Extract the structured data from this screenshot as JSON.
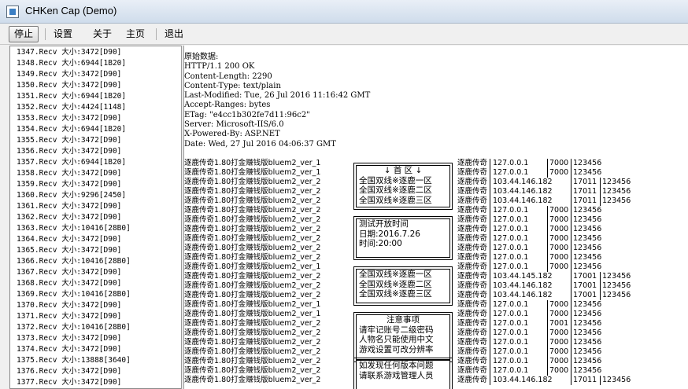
{
  "window": {
    "title": "CHKen Cap (Demo)"
  },
  "menu": {
    "stop": "停止",
    "settings": "设置",
    "about": "关于",
    "home": "主页",
    "exit": "退出"
  },
  "packets": [
    "1347.Recv 大小:3472[D90]",
    "1348.Recv 大小:6944[1B20]",
    "1349.Recv 大小:3472[D90]",
    "1350.Recv 大小:3472[D90]",
    "1351.Recv 大小:6944[1B20]",
    "1352.Recv 大小:4424[1148]",
    "1353.Recv 大小:3472[D90]",
    "1354.Recv 大小:6944[1B20]",
    "1355.Recv 大小:3472[D90]",
    "1356.Recv 大小:3472[D90]",
    "1357.Recv 大小:6944[1B20]",
    "1358.Recv 大小:3472[D90]",
    "1359.Recv 大小:3472[D90]",
    "1360.Recv 大小:9296[2450]",
    "1361.Recv 大小:3472[D90]",
    "1362.Recv 大小:3472[D90]",
    "1363.Recv 大小:10416[28B0]",
    "1364.Recv 大小:3472[D90]",
    "1365.Recv 大小:3472[D90]",
    "1366.Recv 大小:10416[28B0]",
    "1367.Recv 大小:3472[D90]",
    "1368.Recv 大小:3472[D90]",
    "1369.Recv 大小:10416[28B0]",
    "1370.Recv 大小:3472[D90]",
    "1371.Recv 大小:3472[D90]",
    "1372.Recv 大小:10416[28B0]",
    "1373.Recv 大小:3472[D90]",
    "1374.Recv 大小:3472[D90]",
    "1375.Recv 大小:13888[3640]",
    "1376.Recv 大小:3472[D90]",
    "1377.Recv 大小:3472[D90]"
  ],
  "raw_header": [
    "原始数据:",
    "HTTP/1.1 200 OK",
    "Content-Length: 2290",
    "Content-Type: text/plain",
    "Last-Modified: Tue, 26 Jul 2016 11:16:42 GMT",
    "Accept-Ranges: bytes",
    "ETag: \"e4cc1b302fe7d11:96c2\"",
    "Server: Microsoft-IIS/6.0",
    "X-Powered-By: ASP.NET",
    "Date: Wed, 27 Jul 2016 04:06:37 GMT"
  ],
  "rows": [
    {
      "name": "逐鹿传奇1.80打金赚钱版bluem2_ver_1",
      "game": "逐鹿传奇",
      "ip": "127.0.0.1",
      "port": "7000",
      "pwd": "123456"
    },
    {
      "name": "逐鹿传奇1.80打金赚钱版bluem2_ver_1",
      "game": "逐鹿传奇",
      "ip": "127.0.0.1",
      "port": "7000",
      "pwd": "123456"
    },
    {
      "name": "逐鹿传奇1.80打金赚钱版bluem2_ver_2",
      "game": "逐鹿传奇",
      "ip": "103.44.146.182",
      "port": "17011",
      "pwd": "123456"
    },
    {
      "name": "逐鹿传奇1.80打金赚钱版bluem2_ver_2",
      "game": "逐鹿传奇",
      "ip": "103.44.146.182",
      "port": "17011",
      "pwd": "123456"
    },
    {
      "name": "逐鹿传奇1.80打金赚钱版bluem2_ver_2",
      "game": "逐鹿传奇",
      "ip": "103.44.146.182",
      "port": "17011",
      "pwd": "123456"
    },
    {
      "name": "逐鹿传奇1.80打金赚钱版bluem2_ver_2",
      "game": "逐鹿传奇",
      "ip": "127.0.0.1",
      "port": "7000",
      "pwd": "123456"
    },
    {
      "name": "逐鹿传奇1.80打金赚钱版bluem2_ver_2",
      "game": "逐鹿传奇",
      "ip": "127.0.0.1",
      "port": "7000",
      "pwd": "123456"
    },
    {
      "name": "逐鹿传奇1.80打金赚钱版bluem2_ver_2",
      "game": "逐鹿传奇",
      "ip": "127.0.0.1",
      "port": "7000",
      "pwd": "123456"
    },
    {
      "name": "逐鹿传奇1.80打金赚钱版bluem2_ver_2",
      "game": "逐鹿传奇",
      "ip": "127.0.0.1",
      "port": "7000",
      "pwd": "123456"
    },
    {
      "name": "逐鹿传奇1.80打金赚钱版bluem2_ver_2",
      "game": "逐鹿传奇",
      "ip": "127.0.0.1",
      "port": "7000",
      "pwd": "123456"
    },
    {
      "name": "逐鹿传奇1.80打金赚钱版bluem2_ver_2",
      "game": "逐鹿传奇",
      "ip": "127.0.0.1",
      "port": "7000",
      "pwd": "123456"
    },
    {
      "name": "逐鹿传奇1.80打金赚钱版bluem2_ver_1",
      "game": "逐鹿传奇",
      "ip": "127.0.0.1",
      "port": "7000",
      "pwd": "123456"
    },
    {
      "name": "逐鹿传奇1.80打金赚钱版bluem2_ver_2",
      "game": "逐鹿传奇",
      "ip": "103.44.145.182",
      "port": "17001",
      "pwd": "123456"
    },
    {
      "name": "逐鹿传奇1.80打金赚钱版bluem2_ver_2",
      "game": "逐鹿传奇",
      "ip": "103.44.146.182",
      "port": "17001",
      "pwd": "123456"
    },
    {
      "name": "逐鹿传奇1.80打金赚钱版bluem2_ver_2",
      "game": "逐鹿传奇",
      "ip": "103.44.146.182",
      "port": "17001",
      "pwd": "123456"
    },
    {
      "name": "逐鹿传奇1.80打金赚钱版bluem2_ver_1",
      "game": "逐鹿传奇",
      "ip": "127.0.0.1",
      "port": "7000",
      "pwd": "123456"
    },
    {
      "name": "逐鹿传奇1.80打金赚钱版bluem2_ver_1",
      "game": "逐鹿传奇",
      "ip": "127.0.0.1",
      "port": "7000",
      "pwd": "123456"
    },
    {
      "name": "逐鹿传奇1.80打金赚钱版bluem2_ver_2",
      "game": "逐鹿传奇",
      "ip": "127.0.0.1",
      "port": "7001",
      "pwd": "123456"
    },
    {
      "name": "逐鹿传奇1.80打金赚钱版bluem2_ver_2",
      "game": "逐鹿传奇",
      "ip": "127.0.0.1",
      "port": "7000",
      "pwd": "123456"
    },
    {
      "name": "逐鹿传奇1.80打金赚钱版bluem2_ver_2",
      "game": "逐鹿传奇",
      "ip": "127.0.0.1",
      "port": "7000",
      "pwd": "123456"
    },
    {
      "name": "逐鹿传奇1.80打金赚钱版bluem2_ver_2",
      "game": "逐鹿传奇",
      "ip": "127.0.0.1",
      "port": "7000",
      "pwd": "123456"
    },
    {
      "name": "逐鹿传奇1.80打金赚钱版bluem2_ver_2",
      "game": "逐鹿传奇",
      "ip": "127.0.0.1",
      "port": "7000",
      "pwd": "123456"
    },
    {
      "name": "逐鹿传奇1.80打金赚钱版bluem2_ver_2",
      "game": "逐鹿传奇",
      "ip": "127.0.0.1",
      "port": "7000",
      "pwd": "123456"
    },
    {
      "name": "逐鹿传奇1.80打金赚钱版bluem2_ver_2",
      "game": "逐鹿传奇",
      "ip": "103.44.146.182",
      "port": "17011",
      "pwd": "123456"
    }
  ],
  "boxes": {
    "region": [
      "↓    首    区    ↓",
      "全国双线※逐鹿一区",
      "全国双线※逐鹿二区",
      "全国双线※逐鹿三区"
    ],
    "opening": [
      "测试开放时间",
      "日期:2016.7.26",
      "时间:20:00"
    ],
    "lines": [
      "全国双线※逐鹿一区",
      "全国双线※逐鹿二区",
      "全国双线※逐鹿三区"
    ],
    "notice": [
      "注意事项",
      "请牢记账号二级密码",
      "人物名只能使用中文",
      "游戏设置可改分辨率"
    ],
    "footer": [
      "如发现任何版本问题",
      "请联系游戏管理人员"
    ]
  }
}
